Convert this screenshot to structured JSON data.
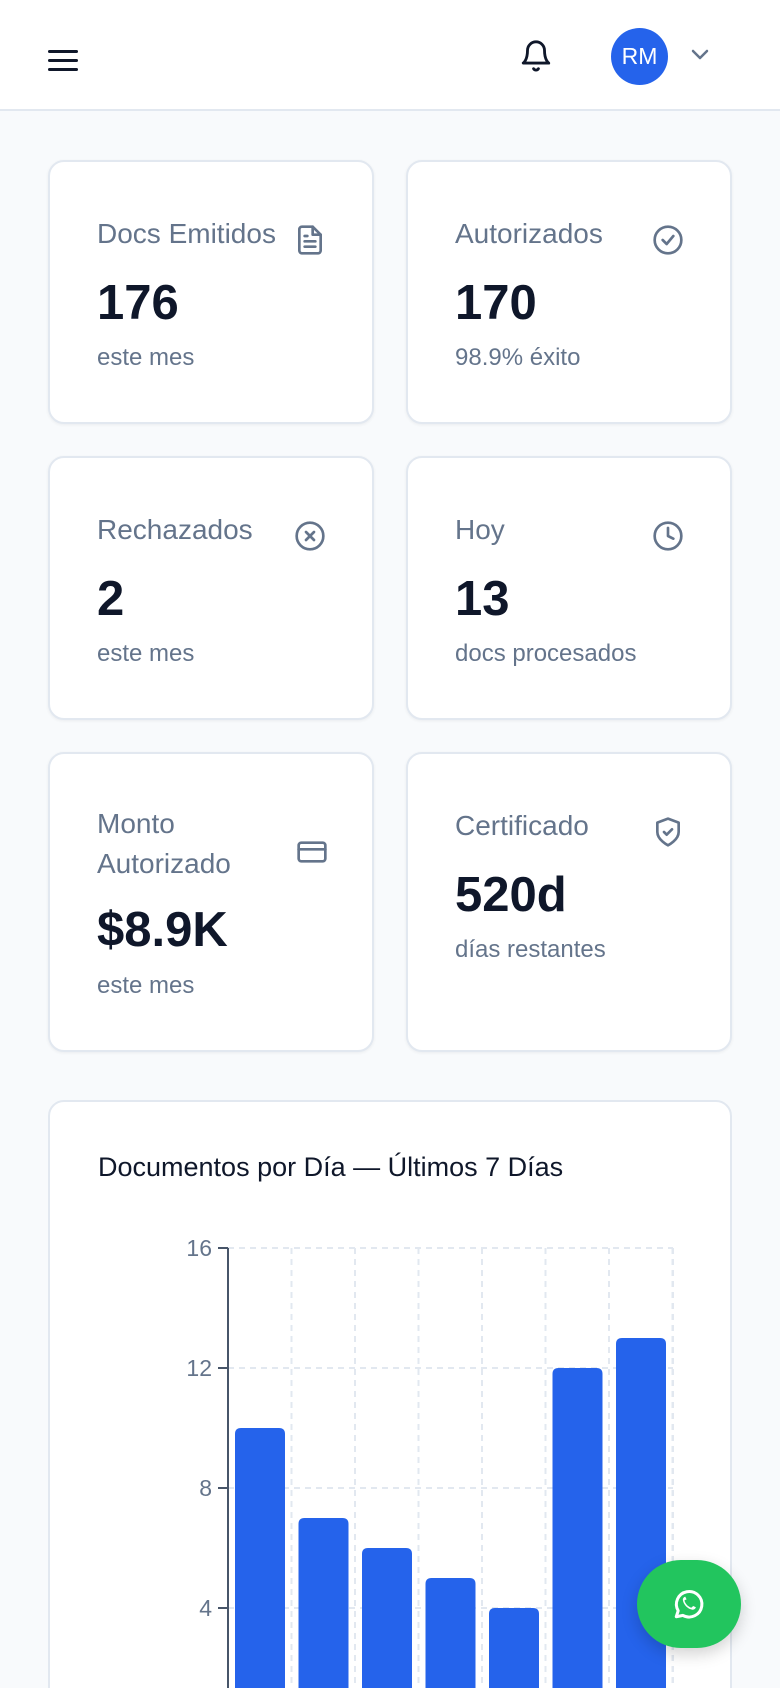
{
  "header": {
    "avatar_initials": "RM"
  },
  "cards": [
    {
      "label": "Docs Emitidos",
      "value": "176",
      "sub": "este mes",
      "icon": "document-icon"
    },
    {
      "label": "Autorizados",
      "value": "170",
      "sub": "98.9% éxito",
      "icon": "check-circle-icon"
    },
    {
      "label": "Rechazados",
      "value": "2",
      "sub": "este mes",
      "icon": "x-circle-icon"
    },
    {
      "label": "Hoy",
      "value": "13",
      "sub": "docs procesados",
      "icon": "clock-icon"
    },
    {
      "label": "Monto Autorizado",
      "value": "$8.9K",
      "sub": "este mes",
      "icon": "credit-card-icon"
    },
    {
      "label": "Certificado",
      "value": "520d",
      "sub": "días restantes",
      "icon": "shield-check-icon"
    }
  ],
  "chart": {
    "title": "Documentos por Día — Últimos 7 Días"
  },
  "chart_data": {
    "type": "bar",
    "title": "Documentos por Día — Últimos 7 Días",
    "categories": [],
    "values": [
      10,
      7,
      6,
      5,
      4,
      12,
      13
    ],
    "ylim": [
      0,
      16
    ],
    "yticks": [
      4,
      8,
      12,
      16
    ],
    "grid": true,
    "color": "#2563eb"
  },
  "colors": {
    "accent": "#2563eb",
    "whatsapp": "#22c55e",
    "muted": "#64748b"
  }
}
